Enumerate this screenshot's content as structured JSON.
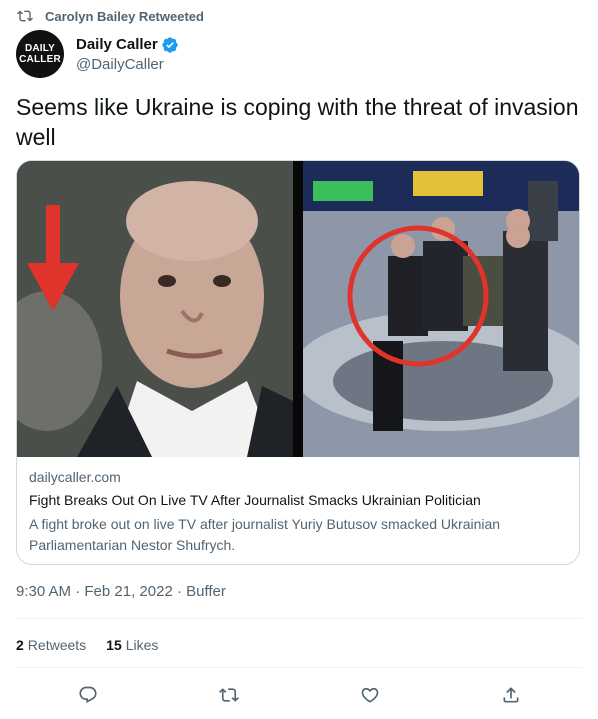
{
  "retweet": {
    "text": "Carolyn Bailey Retweeted"
  },
  "author": {
    "avatar_line1": "DAILY",
    "avatar_line2": "CALLER",
    "display_name": "Daily Caller",
    "handle": "@DailyCaller",
    "verified": true
  },
  "tweet": {
    "text": "Seems like Ukraine is coping with the threat of invasion well"
  },
  "card": {
    "domain": "dailycaller.com",
    "title": "Fight Breaks Out On Live TV After Journalist Smacks Ukrainian Politician",
    "description": "A fight broke out on live TV after journalist Yuriy Butusov smacked Ukrainian Parliamentarian Nestor Shufrych."
  },
  "meta": {
    "time": "9:30 AM",
    "sep1": " · ",
    "date": "Feb 21, 2022",
    "sep2": " · ",
    "source": "Buffer"
  },
  "stats": {
    "retweets_count": "2",
    "retweets_label": "Retweets",
    "likes_count": "15",
    "likes_label": "Likes"
  },
  "icons": [
    "retweet-icon",
    "verified-badge-icon",
    "reply-icon",
    "retweet-action-icon",
    "like-icon",
    "share-icon"
  ],
  "colors": {
    "accent": "#1d9bf0",
    "secondary_text": "#536471",
    "border": "#cfd9de",
    "arrow_red": "#e0332b"
  }
}
